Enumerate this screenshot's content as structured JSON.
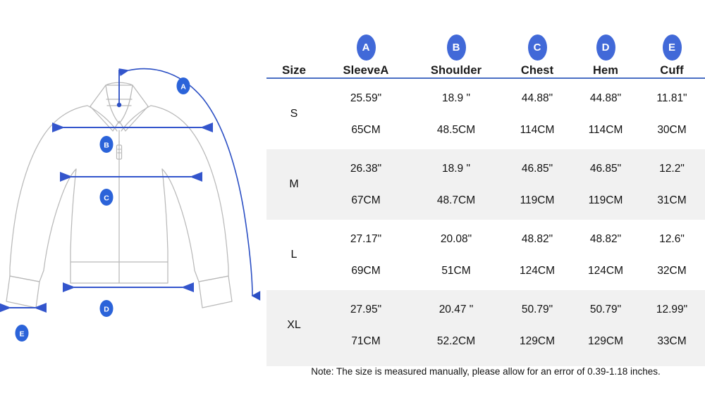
{
  "diagram": {
    "title": "jacket-technical-drawing",
    "outline_color": "#b9b9b9",
    "measure_color": "#3355cc",
    "badge_color": "#2b63d9",
    "markers": [
      {
        "id": "A",
        "label": "A",
        "measurement": "SleeveA"
      },
      {
        "id": "B",
        "label": "B",
        "measurement": "Shoulder"
      },
      {
        "id": "C",
        "label": "C",
        "measurement": "Chest"
      },
      {
        "id": "D",
        "label": "D",
        "measurement": "Hem"
      },
      {
        "id": "E",
        "label": "E",
        "measurement": "Cuff"
      }
    ]
  },
  "table": {
    "accent_color": "#4169d8",
    "rule_color": "#4a6fc4",
    "shaded_row_color": "#f1f1f1",
    "size_header": "Size",
    "columns": [
      {
        "badge": "A",
        "label": "SleeveA"
      },
      {
        "badge": "B",
        "label": "Shoulder"
      },
      {
        "badge": "C",
        "label": "Chest"
      },
      {
        "badge": "D",
        "label": "Hem"
      },
      {
        "badge": "E",
        "label": "Cuff"
      }
    ],
    "rows": [
      {
        "size": "S",
        "shaded": false,
        "inches": [
          "25.59\"",
          "18.9 \"",
          "44.88\"",
          "44.88\"",
          "11.81\""
        ],
        "cm": [
          "65CM",
          "48.5CM",
          "114CM",
          "114CM",
          "30CM"
        ]
      },
      {
        "size": "M",
        "shaded": true,
        "inches": [
          "26.38\"",
          "18.9 \"",
          "46.85\"",
          "46.85\"",
          "12.2\""
        ],
        "cm": [
          "67CM",
          "48.7CM",
          "119CM",
          "119CM",
          "31CM"
        ]
      },
      {
        "size": "L",
        "shaded": false,
        "inches": [
          "27.17\"",
          "20.08\"",
          "48.82\"",
          "48.82\"",
          "12.6\""
        ],
        "cm": [
          "69CM",
          "51CM",
          "124CM",
          "124CM",
          "32CM"
        ]
      },
      {
        "size": "XL",
        "shaded": true,
        "inches": [
          "27.95\"",
          "20.47 \"",
          "50.79\"",
          "50.79\"",
          "12.99\""
        ],
        "cm": [
          "71CM",
          "52.2CM",
          "129CM",
          "129CM",
          "33CM"
        ]
      }
    ],
    "note": "Note: The size is measured manually, please allow for an error of 0.39-1.18 inches."
  },
  "chart_data": {
    "type": "table",
    "title": "Garment Size Chart",
    "categories": [
      "S",
      "M",
      "L",
      "XL"
    ],
    "measurements": [
      "SleeveA",
      "Shoulder",
      "Chest",
      "Hem",
      "Cuff"
    ],
    "units": [
      "inch",
      "cm"
    ],
    "series": [
      {
        "name": "SleeveA",
        "unit": "inch",
        "values": [
          25.59,
          26.38,
          27.17,
          27.95
        ]
      },
      {
        "name": "SleeveA",
        "unit": "cm",
        "values": [
          65,
          67,
          69,
          71
        ]
      },
      {
        "name": "Shoulder",
        "unit": "inch",
        "values": [
          18.9,
          18.9,
          20.08,
          20.47
        ]
      },
      {
        "name": "Shoulder",
        "unit": "cm",
        "values": [
          48.5,
          48.7,
          51,
          52.2
        ]
      },
      {
        "name": "Chest",
        "unit": "inch",
        "values": [
          44.88,
          46.85,
          48.82,
          50.79
        ]
      },
      {
        "name": "Chest",
        "unit": "cm",
        "values": [
          114,
          119,
          124,
          129
        ]
      },
      {
        "name": "Hem",
        "unit": "inch",
        "values": [
          44.88,
          46.85,
          48.82,
          50.79
        ]
      },
      {
        "name": "Hem",
        "unit": "cm",
        "values": [
          114,
          119,
          124,
          129
        ]
      },
      {
        "name": "Cuff",
        "unit": "inch",
        "values": [
          11.81,
          12.2,
          12.6,
          12.99
        ]
      },
      {
        "name": "Cuff",
        "unit": "cm",
        "values": [
          30,
          31,
          32,
          33
        ]
      }
    ],
    "note": "Note: The size is measured manually, please allow for an error of 0.39-1.18 inches."
  }
}
